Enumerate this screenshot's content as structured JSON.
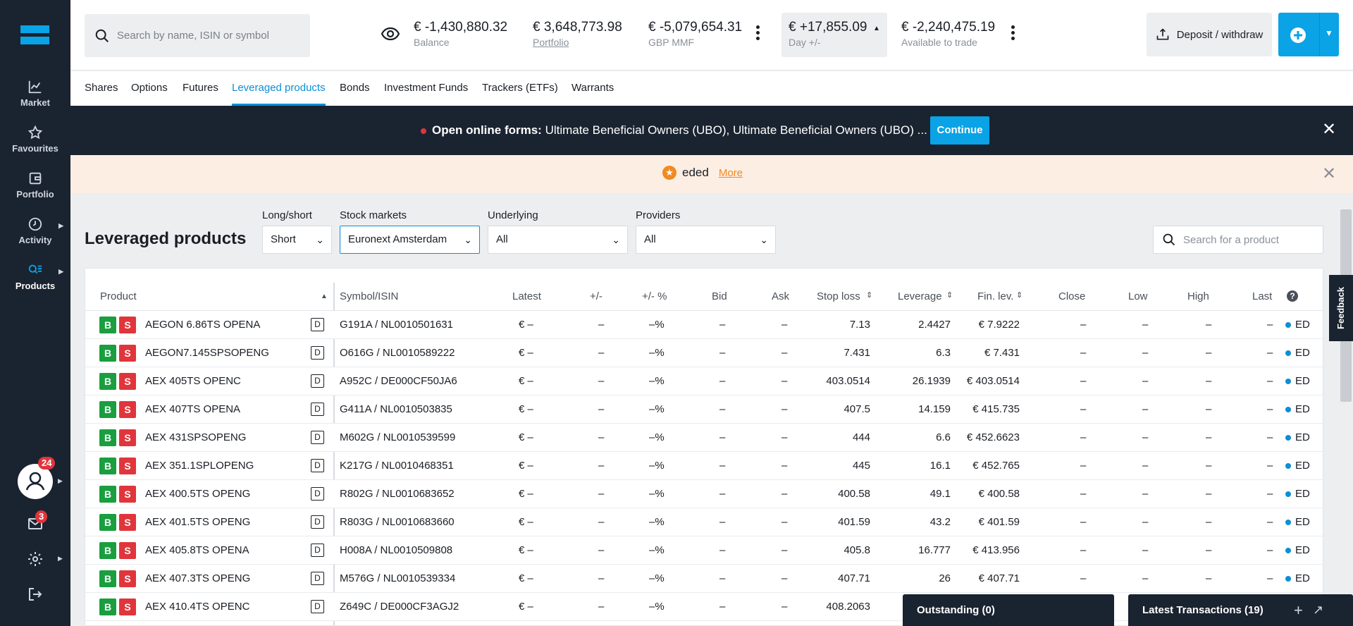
{
  "sidebar": {
    "items": [
      {
        "label": "Market",
        "icon": "chart-line-icon"
      },
      {
        "label": "Favourites",
        "icon": "star-icon"
      },
      {
        "label": "Portfolio",
        "icon": "wallet-icon"
      },
      {
        "label": "Activity",
        "icon": "clock-icon"
      },
      {
        "label": "Products",
        "icon": "products-icon"
      }
    ],
    "profile_badge": "24",
    "mail_badge": "3"
  },
  "header": {
    "search_placeholder": "Search by name, ISIN or symbol",
    "balance_value": "€ -1,430,880.32",
    "balance_label": "Balance",
    "portfolio_value": "€ 3,648,773.98",
    "portfolio_label": "Portfolio",
    "mmf_value": "€ -5,079,654.31",
    "mmf_label": "GBP MMF",
    "day_value": "€ +17,855.09",
    "day_label": "Day +/-",
    "available_value": "€ -2,240,475.19",
    "available_label": "Available to trade",
    "deposit_label": "Deposit / withdraw"
  },
  "tabs": [
    "Shares",
    "Options",
    "Futures",
    "Leveraged products",
    "Bonds",
    "Investment Funds",
    "Trackers (ETFs)",
    "Warrants"
  ],
  "alert": {
    "bold": "Open online forms:",
    "text": " Ultimate Beneficial Owners (UBO), Ultimate Beneficial Owners (UBO) ...",
    "button": "Continue"
  },
  "notice": {
    "text": "eded",
    "link": "More"
  },
  "filters": {
    "title": "Leveraged products",
    "long_short_label": "Long/short",
    "long_short_value": "Short",
    "markets_label": "Stock markets",
    "markets_value": "Euronext Amsterdam",
    "underlying_label": "Underlying",
    "underlying_value": "All",
    "providers_label": "Providers",
    "providers_value": "All",
    "search_placeholder": "Search for a product"
  },
  "table": {
    "headers": [
      "Product",
      "Symbol/ISIN",
      "Latest",
      "+/-",
      "+/- %",
      "Bid",
      "Ask",
      "Stop loss",
      "Leverage",
      "Fin. lev.",
      "Close",
      "Low",
      "High",
      "Last"
    ],
    "rows": [
      {
        "name": "AEGON 6.86TS OPENA",
        "isin": "G191A / NL0010501631",
        "stop": "7.13",
        "lev": "2.4427",
        "fin": "€ 7.9222"
      },
      {
        "name": "AEGON7.145SPSOPENG",
        "isin": "O616G / NL0010589222",
        "stop": "7.431",
        "lev": "6.3",
        "fin": "€ 7.431"
      },
      {
        "name": "AEX 405TS OPENC",
        "isin": "A952C / DE000CF50JA6",
        "stop": "403.0514",
        "lev": "26.1939",
        "fin": "€ 403.0514"
      },
      {
        "name": "AEX 407TS OPENA",
        "isin": "G411A / NL0010503835",
        "stop": "407.5",
        "lev": "14.159",
        "fin": "€ 415.735"
      },
      {
        "name": "AEX 431SPSOPENG",
        "isin": "M602G / NL0010539599",
        "stop": "444",
        "lev": "6.6",
        "fin": "€ 452.6623"
      },
      {
        "name": "AEX 351.1SPLOPENG",
        "isin": "K217G / NL0010468351",
        "stop": "445",
        "lev": "16.1",
        "fin": "€ 452.765"
      },
      {
        "name": "AEX 400.5TS OPENG",
        "isin": "R802G / NL0010683652",
        "stop": "400.58",
        "lev": "49.1",
        "fin": "€ 400.58"
      },
      {
        "name": "AEX 401.5TS OPENG",
        "isin": "R803G / NL0010683660",
        "stop": "401.59",
        "lev": "43.2",
        "fin": "€ 401.59"
      },
      {
        "name": "AEX 405.8TS OPENA",
        "isin": "H008A / NL0010509808",
        "stop": "405.8",
        "lev": "16.777",
        "fin": "€ 413.956"
      },
      {
        "name": "AEX 407.3TS OPENG",
        "isin": "M576G / NL0010539334",
        "stop": "407.71",
        "lev": "26",
        "fin": "€ 407.71"
      },
      {
        "name": "AEX 410.4TS OPENC",
        "isin": "Z649C / DE000CF3AGJ2",
        "stop": "408.2063",
        "lev": "",
        "fin": ""
      }
    ],
    "dash": "–",
    "euro_dash": "€ –",
    "pct_dash": "–%",
    "b": "B",
    "s": "S",
    "d": "D",
    "ed": "ED"
  },
  "panels": {
    "outstanding": "Outstanding (0)",
    "latest": "Latest Transactions (19)"
  },
  "feedback": "Feedback"
}
